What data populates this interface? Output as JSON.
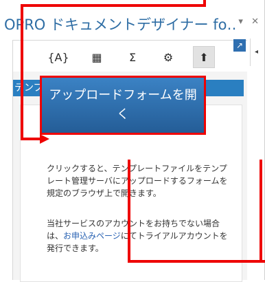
{
  "pane": {
    "title": "OPRO ドキュメントデザイナー fo…",
    "controls": [
      "▾",
      "✕"
    ]
  },
  "toolbar": {
    "tools": [
      {
        "name": "variable",
        "glyph": "{A}"
      },
      {
        "name": "table",
        "glyph": "▦"
      },
      {
        "name": "sum",
        "glyph": "Σ"
      },
      {
        "name": "settings",
        "glyph": "⚙"
      },
      {
        "name": "upload",
        "glyph": "⬆"
      }
    ]
  },
  "content": {
    "banner": "テンプレートをアップロードします。",
    "button_label": "アップロードフォームを開く",
    "para1": "クリックすると、テンプレートファイルをテンプレート管理サーバにアップロードするフォームを規定のブラウザ上で開きます。",
    "para2_before": "当社サービスのアカウントをお持ちでない場合は、",
    "para2_link": "お申込みページ",
    "para2_after": "にてトライアルアカウントを発行できます。"
  }
}
